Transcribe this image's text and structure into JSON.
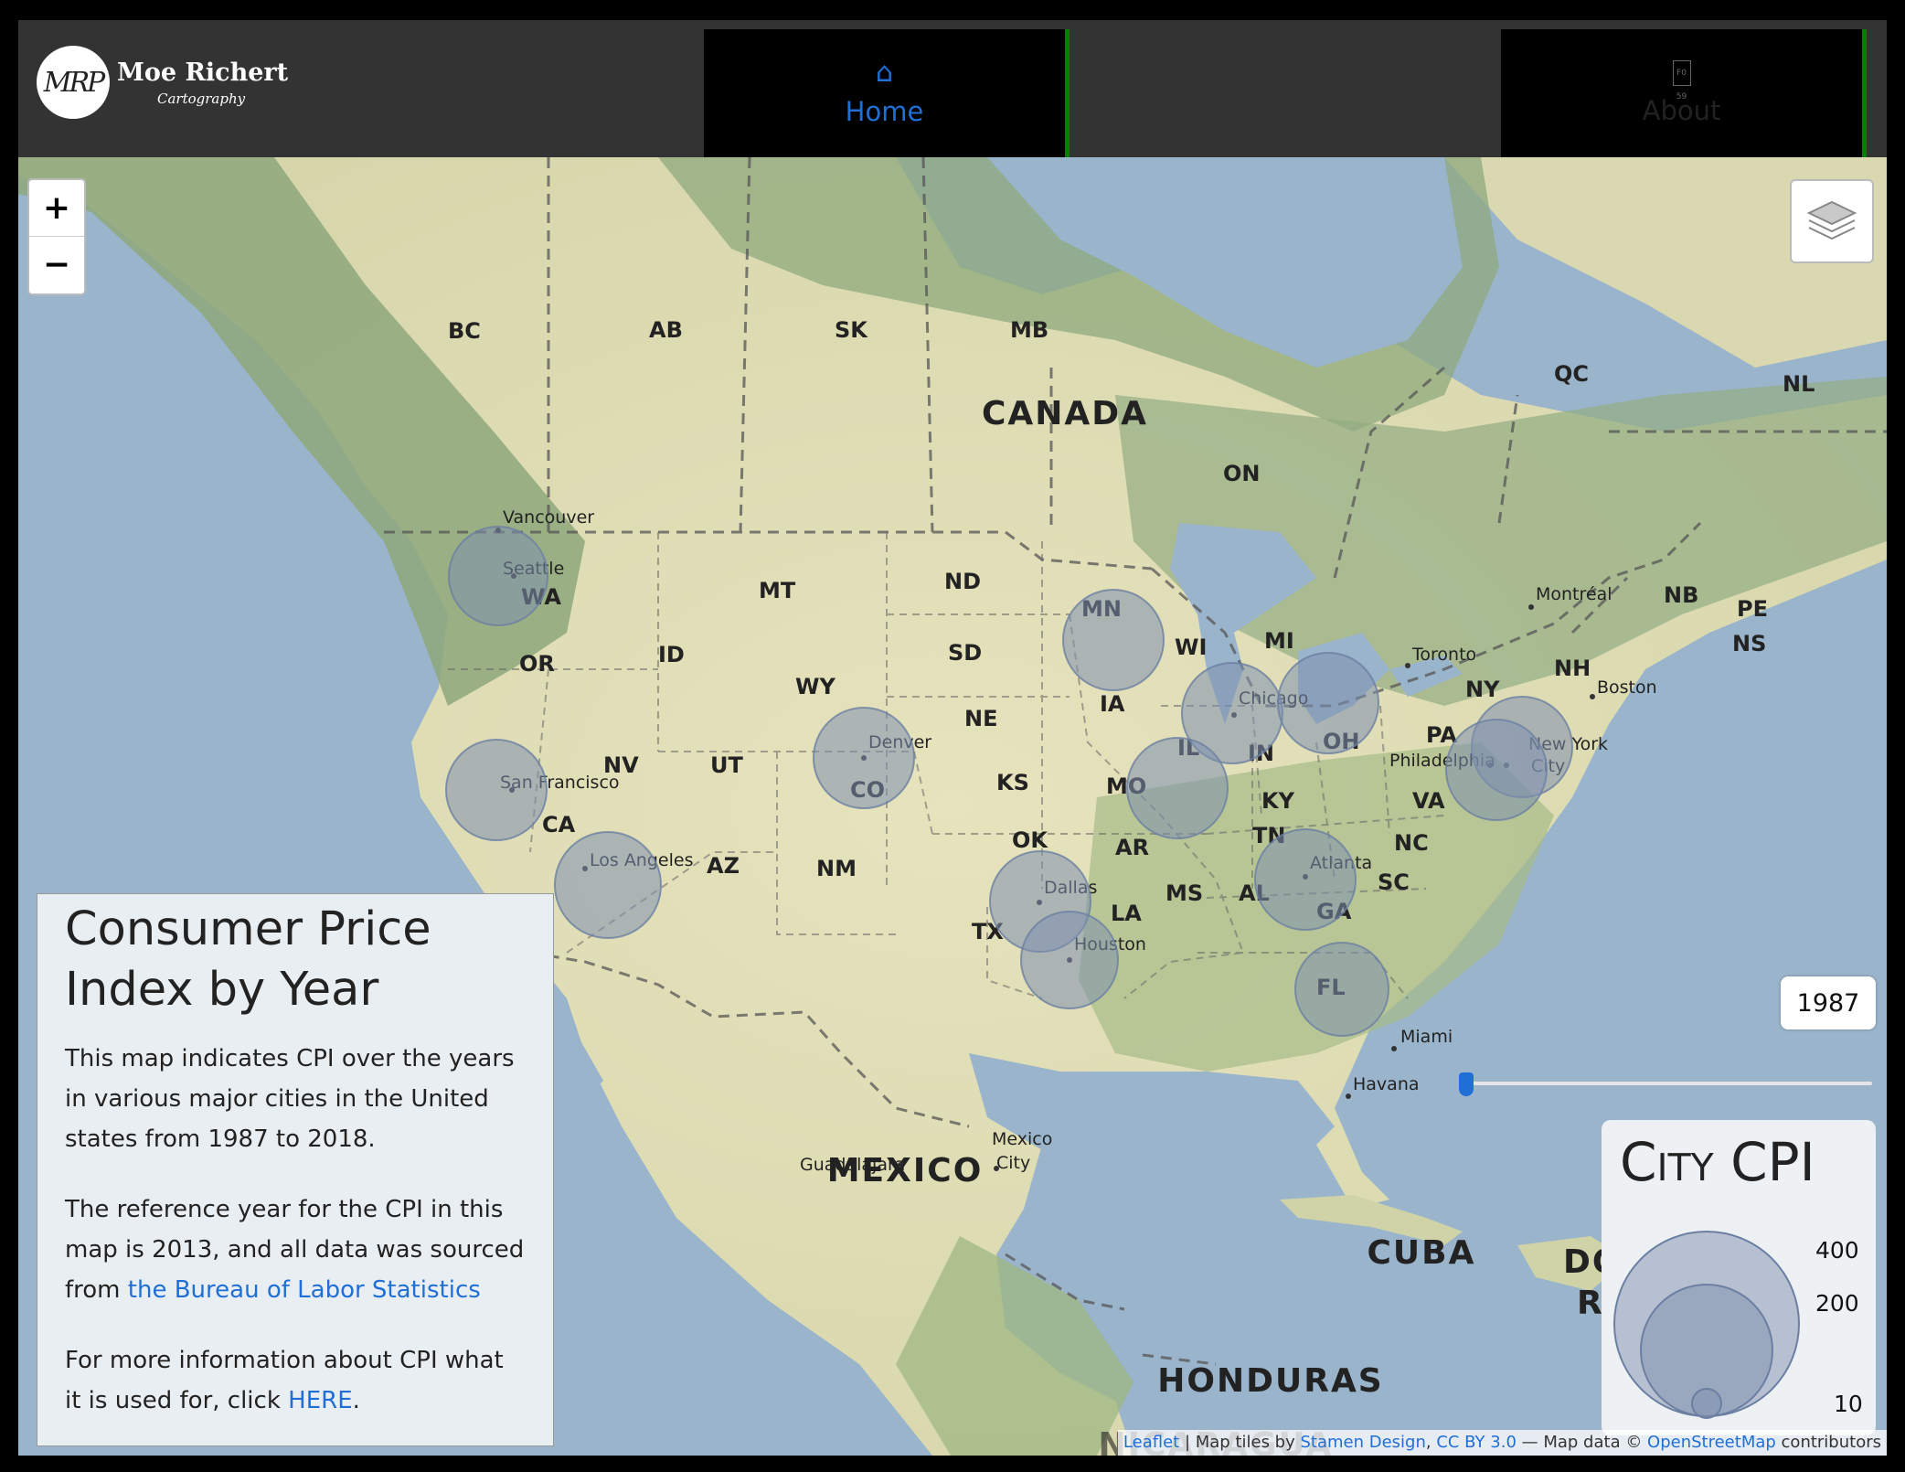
{
  "brand": {
    "logo_text": "MRP",
    "name": "Moe Richert",
    "subtitle": "Cartography"
  },
  "nav": {
    "home": {
      "icon": "home-icon",
      "label": "Home"
    },
    "about": {
      "icon": "document-icon",
      "label": "About"
    }
  },
  "map": {
    "zoom_in": "+",
    "zoom_out": "−",
    "layers_icon": "layers-icon",
    "year": "1987",
    "year_range": [
      1987,
      2018
    ],
    "slider_value": 1987,
    "countries": [
      "CANADA",
      "MEXICO",
      "CUBA",
      "HONDURAS",
      "DOMINICAN REPUBLIC",
      "NICARAGUA"
    ],
    "regions": [
      "BC",
      "AB",
      "SK",
      "MB",
      "QC",
      "NL",
      "ON",
      "NB",
      "PE",
      "NS",
      "WA",
      "OR",
      "ID",
      "MT",
      "ND",
      "MN",
      "WI",
      "MI",
      "SD",
      "WY",
      "NV",
      "UT",
      "CO",
      "NE",
      "IA",
      "IL",
      "IN",
      "OH",
      "NY",
      "PA",
      "NH",
      "CA",
      "AZ",
      "NM",
      "KS",
      "MO",
      "KY",
      "VA",
      "OK",
      "AR",
      "TN",
      "NC",
      "TX",
      "MS",
      "AL",
      "SC",
      "LA",
      "GA",
      "FL"
    ],
    "cities": [
      {
        "name": "Vancouver"
      },
      {
        "name": "Seattle"
      },
      {
        "name": "San Francisco"
      },
      {
        "name": "Los Angeles"
      },
      {
        "name": "Denver"
      },
      {
        "name": "Dallas"
      },
      {
        "name": "Houston"
      },
      {
        "name": "Chicago"
      },
      {
        "name": "Atlanta"
      },
      {
        "name": "Toronto"
      },
      {
        "name": "Montréal"
      },
      {
        "name": "Boston"
      },
      {
        "name": "New York City"
      },
      {
        "name": "Philadelphia"
      },
      {
        "name": "Miami"
      },
      {
        "name": "Havana"
      },
      {
        "name": "Mexico City"
      },
      {
        "name": "Guadalajara"
      }
    ]
  },
  "info": {
    "title": "Consumer Price Index by Year",
    "para1": "This map indicates CPI over the years in various major cities in the United states from 1987 to 2018.",
    "para2_prefix": "The reference year for the CPI in this map is 2013, and all data was sourced from ",
    "para2_link": "the Bureau of Labor Statistics",
    "para3_prefix": "For more information about CPI what it is used for, click ",
    "para3_link": "HERE",
    "para3_suffix": "."
  },
  "legend": {
    "title": "City CPI",
    "values": [
      "400",
      "200",
      "10"
    ]
  },
  "attribution": {
    "leaflet": "Leaflet",
    "sep1": " | Map tiles by ",
    "stamen": "Stamen Design",
    "sep2": ", ",
    "cc": "CC BY 3.0",
    "sep3": " — Map data © ",
    "osm": "OpenStreetMap",
    "suffix": " contributors"
  },
  "colors": {
    "accent": "#1f6fd6",
    "nav_bg": "#333333",
    "active_border": "#0a7d0a",
    "circle_fill": "#7d8fae"
  }
}
